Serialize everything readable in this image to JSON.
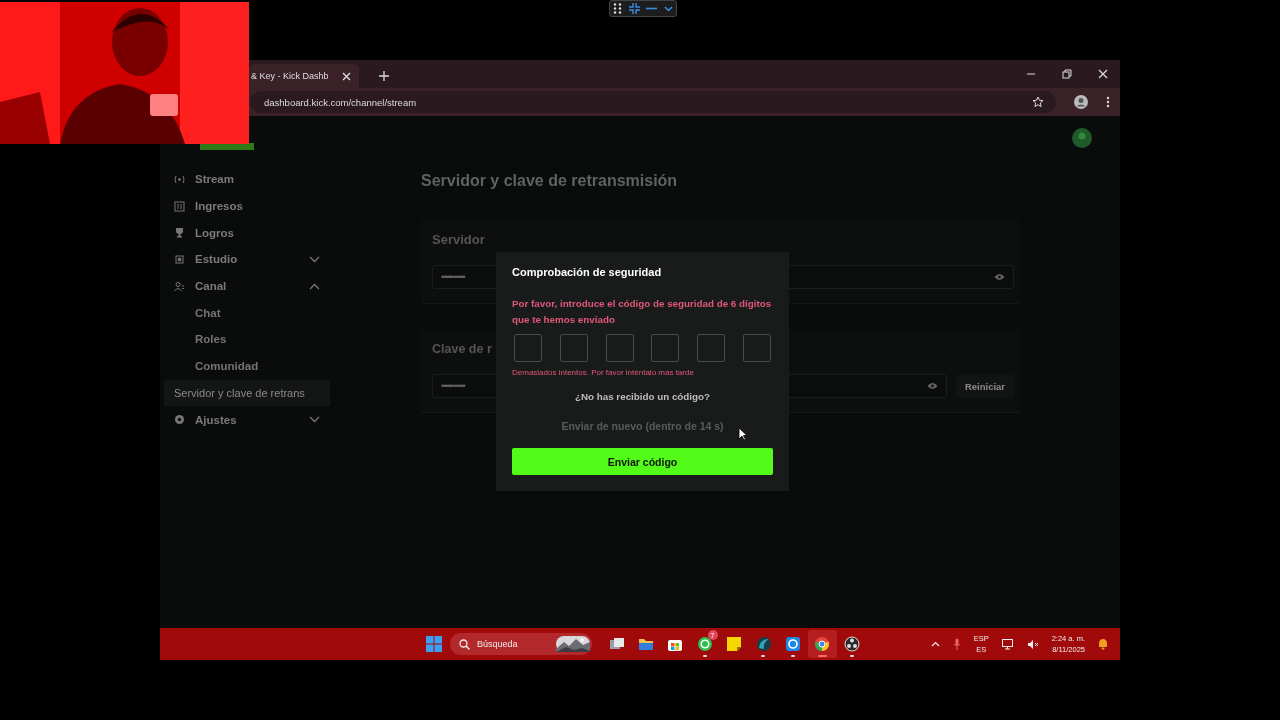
{
  "share_toolbar": {
    "visible": true
  },
  "browser": {
    "tab": {
      "title": "& Key - Kick Dashb",
      "selected": true
    },
    "address": "dashboard.kick.com/channel/stream"
  },
  "sidebar": {
    "items": [
      {
        "label": "Stream",
        "kind": "stream"
      },
      {
        "label": "Ingresos",
        "kind": "income"
      },
      {
        "label": "Logros",
        "kind": "trophy"
      },
      {
        "label": "Estudio",
        "kind": "studio",
        "expanded": false
      },
      {
        "label": "Canal",
        "kind": "channel",
        "expanded": true,
        "children": [
          {
            "label": "Chat",
            "selected": false
          },
          {
            "label": "Roles",
            "selected": false
          },
          {
            "label": "Comunidad",
            "selected": false
          },
          {
            "label": "Servidor y clave de retrans",
            "selected": true
          }
        ]
      },
      {
        "label": "Ajustes",
        "kind": "settings",
        "expanded": false
      }
    ]
  },
  "main": {
    "title": "Servidor y clave de retransmisión",
    "server": {
      "label": "Servidor",
      "value": "•••••••••••"
    },
    "key": {
      "label": "Clave de r",
      "value": "•••••••••••",
      "button": "Reiniciar"
    }
  },
  "modal": {
    "title": "Comprobación de seguridad",
    "prompt": "Por favor, introduce el código de seguridad de 6 dígitos que te hemos enviado",
    "code_boxes": [
      {
        "filled": false
      },
      {
        "filled": false
      },
      {
        "filled": false
      },
      {
        "filled": false
      },
      {
        "filled": false
      },
      {
        "filled": false
      }
    ],
    "error": "Demasiados intentos. Por favor inténtalo más tarde",
    "question": "¿No has recibido un código?",
    "resend": {
      "label": "Enviar de nuevo (dentro de 14 s)",
      "disabled": true
    },
    "submit": "Enviar código"
  },
  "taskbar": {
    "search_placeholder": "Búsqueda",
    "apps": [
      {
        "kind": "taskview",
        "running": false,
        "active": false
      },
      {
        "kind": "folder",
        "running": false,
        "active": false
      },
      {
        "kind": "store",
        "running": false,
        "active": false
      },
      {
        "kind": "chat",
        "running": true,
        "active": false,
        "badge": "7"
      },
      {
        "kind": "notes",
        "running": false,
        "active": false
      },
      {
        "kind": "wave",
        "running": true,
        "active": false
      },
      {
        "kind": "sync",
        "running": true,
        "active": false
      },
      {
        "kind": "browser",
        "running": true,
        "active": true
      },
      {
        "kind": "camera",
        "running": true,
        "active": false
      }
    ],
    "language": "ESP",
    "layout": "ES",
    "time": "2:24 a. m.",
    "date": "8/11/2025"
  }
}
